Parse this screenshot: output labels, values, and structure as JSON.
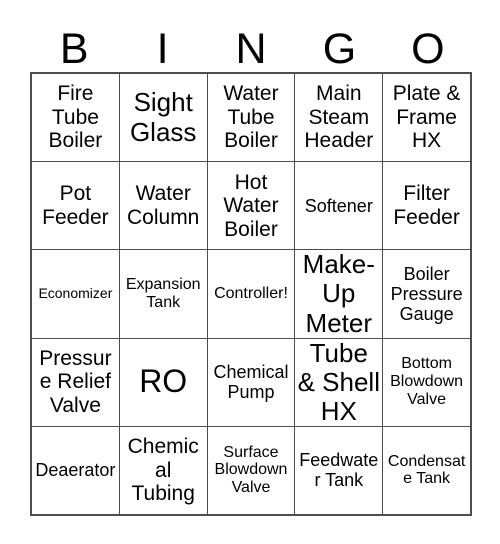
{
  "card": {
    "title": "Bingo Card",
    "header_letters": [
      "B",
      "I",
      "N",
      "G",
      "O"
    ],
    "columns": 5,
    "rows": 5,
    "border_color": "#4d4d4d",
    "text_color": "#000000",
    "background_color": "#ffffff",
    "cells": [
      [
        {
          "text": "Fire Tube Boiler",
          "size": "md"
        },
        {
          "text": "Sight Glass",
          "size": "lg"
        },
        {
          "text": "Water Tube Boiler",
          "size": "md"
        },
        {
          "text": "Main Steam Header",
          "size": "md"
        },
        {
          "text": "Plate & Frame HX",
          "size": "md"
        }
      ],
      [
        {
          "text": "Pot Feeder",
          "size": "md"
        },
        {
          "text": "Water Column",
          "size": "md"
        },
        {
          "text": "Hot Water Boiler",
          "size": "md"
        },
        {
          "text": "Softener",
          "size": "sm"
        },
        {
          "text": "Filter Feeder",
          "size": "md"
        }
      ],
      [
        {
          "text": "Economizer",
          "size": "xxs"
        },
        {
          "text": "Expansion Tank",
          "size": "xs"
        },
        {
          "text": "Controller!",
          "size": "xs"
        },
        {
          "text": "Make-Up Meter",
          "size": "lg"
        },
        {
          "text": "Boiler Pressure Gauge",
          "size": "sm"
        }
      ],
      [
        {
          "text": "Pressure Relief Valve",
          "size": "md"
        },
        {
          "text": "RO",
          "size": "xl"
        },
        {
          "text": "Chemical Pump",
          "size": "sm"
        },
        {
          "text": "Tube & Shell HX",
          "size": "lg"
        },
        {
          "text": "Bottom Blowdown Valve",
          "size": "xs"
        }
      ],
      [
        {
          "text": "Deaerator",
          "size": "sm"
        },
        {
          "text": "Chemical Tubing",
          "size": "md"
        },
        {
          "text": "Surface Blowdown Valve",
          "size": "xs"
        },
        {
          "text": "Feedwater Tank",
          "size": "sm"
        },
        {
          "text": "Condensate Tank",
          "size": "xs"
        }
      ]
    ]
  }
}
